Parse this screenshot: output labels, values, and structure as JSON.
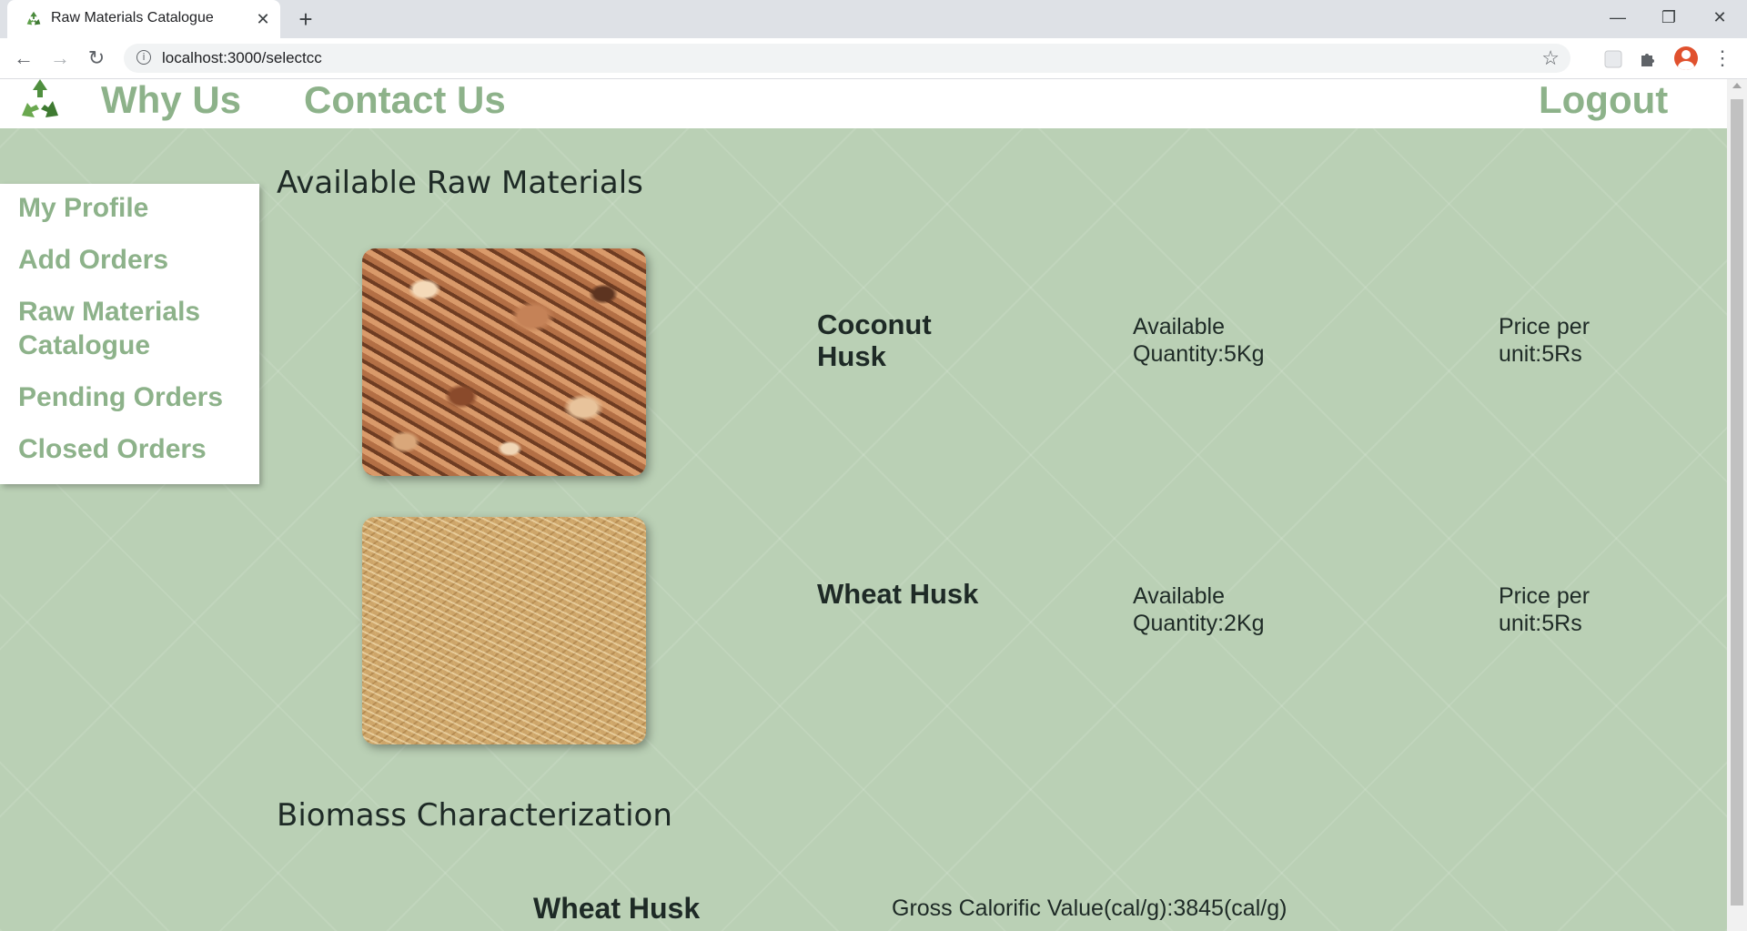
{
  "browser": {
    "tab_title": "Raw Materials Catalogue",
    "tab_close": "✕",
    "new_tab": "+",
    "url": "localhost:3000/selectcc",
    "window_controls": {
      "minimize": "—",
      "restore": "❐",
      "close": "✕"
    }
  },
  "header": {
    "nav": [
      "Why Us",
      "Contact Us"
    ],
    "logout": "Logout",
    "logo_icon": "recycle-icon"
  },
  "sidebar": {
    "items": [
      "My Profile",
      "Add Orders",
      "Raw Materials Catalogue",
      "Pending Orders",
      "Closed Orders"
    ]
  },
  "catalogue": {
    "heading": "Available Raw Materials",
    "items": [
      {
        "name": "Coconut Husk",
        "quantity": "Available Quantity:5Kg",
        "price": "Price per unit:5Rs"
      },
      {
        "name": "Wheat Husk",
        "quantity": "Available Quantity:2Kg",
        "price": "Price per unit:5Rs"
      }
    ]
  },
  "characterization": {
    "heading": "Biomass Characterization",
    "rows": [
      {
        "name": "Wheat Husk",
        "value": "Gross Calorific Value(cal/g):3845(cal/g)"
      }
    ]
  },
  "colors": {
    "accent": "#8db28a",
    "background": "#bad0b5",
    "text": "#1e2a26"
  }
}
